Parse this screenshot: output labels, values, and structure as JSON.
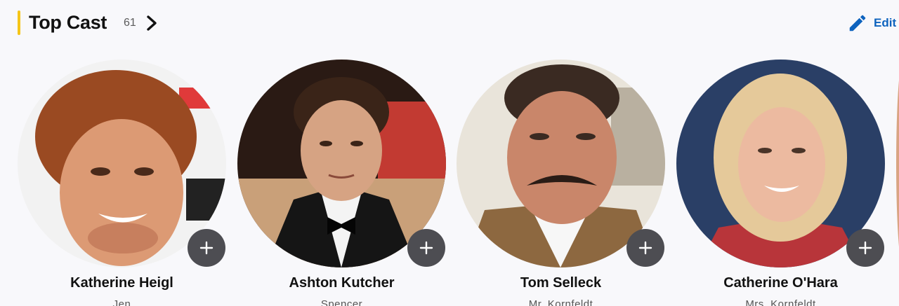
{
  "header": {
    "title": "Top Cast",
    "count": "61",
    "edit_label": "Edit",
    "accent_color": "#f5c518",
    "link_color": "#0e63be"
  },
  "cast": [
    {
      "name": "Katherine Heigl",
      "role": "Jen"
    },
    {
      "name": "Ashton Kutcher",
      "role": "Spencer"
    },
    {
      "name": "Tom Selleck",
      "role": "Mr. Kornfeldt"
    },
    {
      "name": "Catherine O'Hara",
      "role": "Mrs. Kornfeldt"
    }
  ],
  "icons": {
    "chevron": "chevron-right-icon",
    "edit": "pencil-icon",
    "add": "plus-icon"
  }
}
